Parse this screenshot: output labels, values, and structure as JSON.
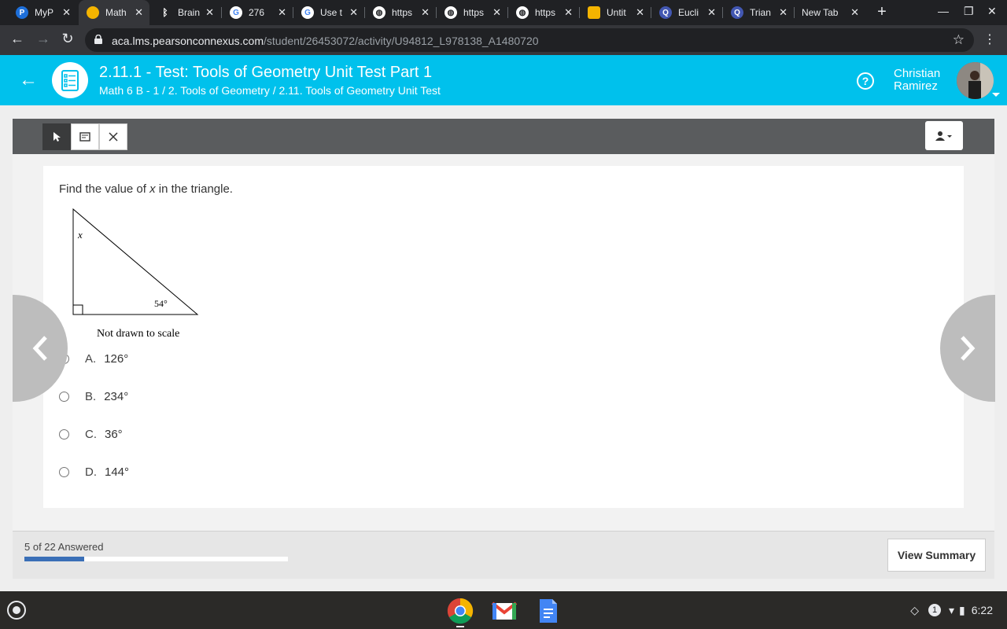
{
  "browser": {
    "tabs": [
      {
        "title": "MyP",
        "favicon": "pearson-p-icon",
        "color": "#1e6fd9"
      },
      {
        "title": "Math",
        "favicon": "pearson-globe-icon",
        "color": "#f4b400",
        "active": true
      },
      {
        "title": "Brain",
        "favicon": "brainly-icon",
        "color": "#202124"
      },
      {
        "title": "276",
        "favicon": "google-icon",
        "color": "#ffffff"
      },
      {
        "title": "Use t",
        "favicon": "google-icon",
        "color": "#ffffff"
      },
      {
        "title": "https",
        "favicon": "globe-icon",
        "color": "#ffffff"
      },
      {
        "title": "https",
        "favicon": "globe-icon",
        "color": "#ffffff"
      },
      {
        "title": "https",
        "favicon": "globe-icon",
        "color": "#ffffff"
      },
      {
        "title": "Untit",
        "favicon": "slides-icon",
        "color": "#f4b400"
      },
      {
        "title": "Eucli",
        "favicon": "quizlet-icon",
        "color": "#4257b2"
      },
      {
        "title": "Trian",
        "favicon": "quizlet-icon",
        "color": "#4257b2"
      },
      {
        "title": "New Tab",
        "favicon": "",
        "color": ""
      }
    ],
    "url_domain": "aca.lms.pearsonconnexus.com",
    "url_path": "/student/26453072/activity/U94812_L978138_A1480720"
  },
  "header": {
    "title": "2.11.1 - Test: Tools of Geometry Unit Test Part 1",
    "breadcrumb": "Math 6 B - 1 / 2. Tools of Geometry / 2.11. Tools of Geometry Unit Test",
    "user_first": "Christian",
    "user_last": "Ramirez",
    "accent": "#00c1ec"
  },
  "question": {
    "prompt_before": "Find the value of ",
    "prompt_var": "x",
    "prompt_after": " in the triangle.",
    "diagram": {
      "vertex_label": "x",
      "angle_label": "54°",
      "caption": "Not drawn to scale"
    },
    "options": [
      {
        "letter": "A.",
        "value": "126°"
      },
      {
        "letter": "B.",
        "value": "234°"
      },
      {
        "letter": "C.",
        "value": "36°"
      },
      {
        "letter": "D.",
        "value": "144°"
      }
    ]
  },
  "footer": {
    "answered_text": "5 of 22 Answered",
    "progress": 0.227,
    "summary_button": "View Summary",
    "progress_color": "#3a6fb7"
  },
  "shelf": {
    "apps": [
      "chrome-icon",
      "gmail-icon",
      "docs-icon"
    ],
    "notification_count": "1",
    "time": "6:22"
  }
}
